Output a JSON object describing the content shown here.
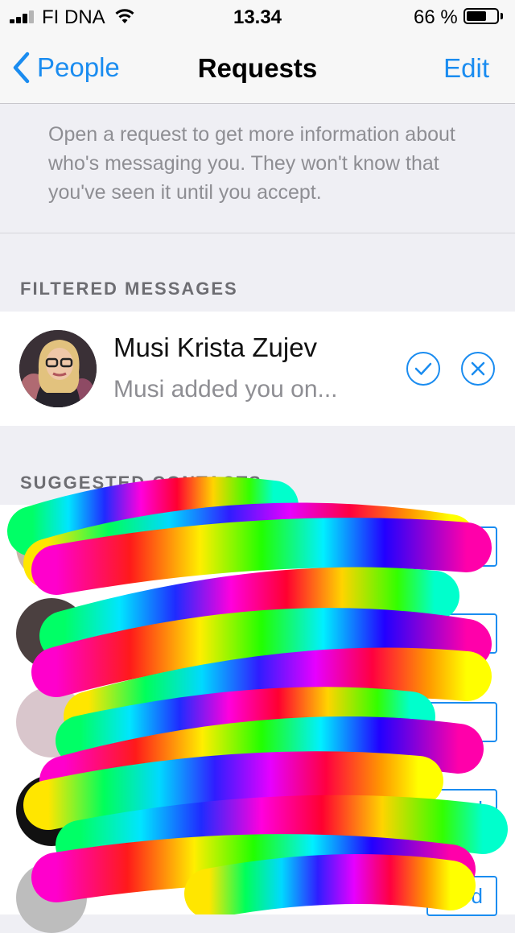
{
  "status_bar": {
    "carrier": "FI DNA",
    "time": "13.34",
    "battery_percent": "66 %",
    "battery_level": 0.66,
    "signal_bars_filled": 3,
    "signal_bars_total": 4
  },
  "nav": {
    "back_label": "People",
    "title": "Requests",
    "edit_label": "Edit",
    "back_icon": "chevron-left-icon"
  },
  "info": {
    "text": "Open a request to get more information about who's messaging you. They won't know that you've seen it until you accept."
  },
  "filtered": {
    "header": "FILTERED MESSAGES",
    "items": [
      {
        "name": "Musi Krista Zujev",
        "preview": "Musi added you on...",
        "accept_icon": "checkmark-icon",
        "decline_icon": "close-icon"
      }
    ]
  },
  "suggested": {
    "header": "SUGGESTED CONTACTS",
    "add_button_labels": [
      "",
      "",
      "",
      "d",
      "d"
    ]
  },
  "colors": {
    "accent": "#1a8cf0",
    "secondary_text": "#8e8e93",
    "background": "#efeff4"
  }
}
